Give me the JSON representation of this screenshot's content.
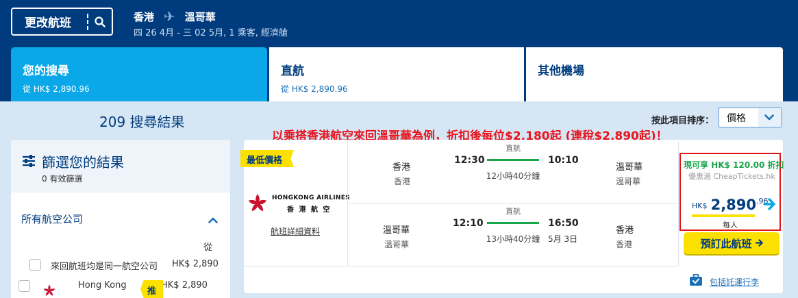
{
  "header": {
    "change_flight_label": "更改航班",
    "origin": "香港",
    "destination": "溫哥華",
    "trip_summary": "四 26 4月 - 三 02 5月, 1 乘客, 經濟艙"
  },
  "tabs": [
    {
      "label": "您的搜尋",
      "sub": "從 HK$ 2,890.96"
    },
    {
      "label": "直航",
      "sub": "從 HK$ 2,890.96"
    },
    {
      "label": "其他機場",
      "sub": ""
    }
  ],
  "results_count": "209 搜尋結果",
  "sort": {
    "label": "按此項目排序：",
    "value": "價格"
  },
  "promo_text": "以乘搭香港航空來回溫哥華為例，折扣後每位$2,180起 (連稅$2,890起)！",
  "filters": {
    "title": "篩選您的結果",
    "active_count": "0 有效篩選",
    "airline_section": "所有航空公司",
    "from_label": "從",
    "rows": [
      {
        "label": "來回航班均是同一航空公司",
        "price": "HK$ 2,890"
      },
      {
        "label": "Hong Kong",
        "price": "HK$ 2,890",
        "tag": "推"
      }
    ]
  },
  "result": {
    "badge": "最低價格",
    "airline_name_en": "HONGKONG AIRLINES",
    "airline_name_zh": "香 港 航 空",
    "detail_link": "航班詳細資料",
    "outbound": {
      "from_city": "香港",
      "from_code": "香港",
      "depart": "12:30",
      "arrive": "10:10",
      "stops": "直航",
      "duration": "12小時40分鐘",
      "to_city": "溫哥華",
      "to_code": "溫哥華"
    },
    "inbound": {
      "from_city": "溫哥華",
      "from_code": "溫哥華",
      "depart": "12:10",
      "arrive": "16:50",
      "stops": "直航",
      "duration": "13小時40分鐘",
      "arrive_date": "5月 3日",
      "to_city": "香港",
      "to_code": "香港"
    },
    "discount_text": "現可享 HK$ 120.00 折扣",
    "via_text": "優惠過 CheapTickets.hk",
    "currency": "HK$",
    "price_main": "2,890",
    "price_cents": ".96",
    "per_person": "每人",
    "book_label": "預訂此航班",
    "baggage_link": "包括託運行李"
  },
  "colors": {
    "brand_dark": "#003c7d",
    "accent_blue": "#0aa8e8",
    "yellow": "#fbe000",
    "promo_red": "#e8141c",
    "green": "#1aa64a"
  }
}
